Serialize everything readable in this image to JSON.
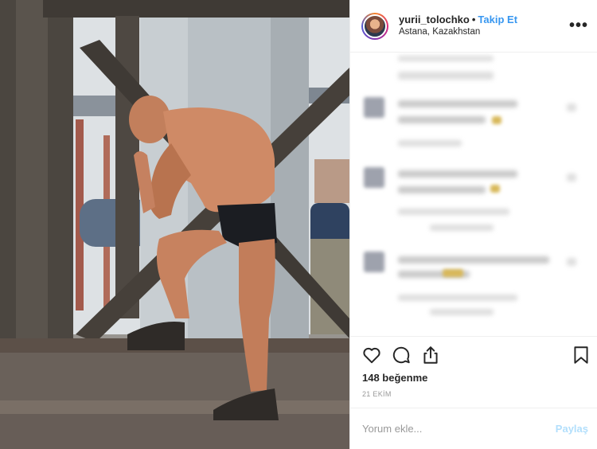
{
  "header": {
    "username": "yurii_tolochko",
    "separator": "•",
    "follow_label": "Takip Et",
    "location": "Astana, Kazakhstan",
    "more_icon": "more-horizontal-icon"
  },
  "actions": {
    "like_icon": "heart-icon",
    "comment_icon": "comment-icon",
    "share_icon": "share-icon",
    "save_icon": "bookmark-icon",
    "likes_text": "148 beğenme",
    "date": "21 EKİM"
  },
  "comment_form": {
    "placeholder": "Yorum ekle...",
    "submit_label": "Paylaş"
  },
  "colors": {
    "link_blue": "#3897f0",
    "submit_disabled": "#b2dffc",
    "text": "#262626",
    "muted": "#999999"
  }
}
